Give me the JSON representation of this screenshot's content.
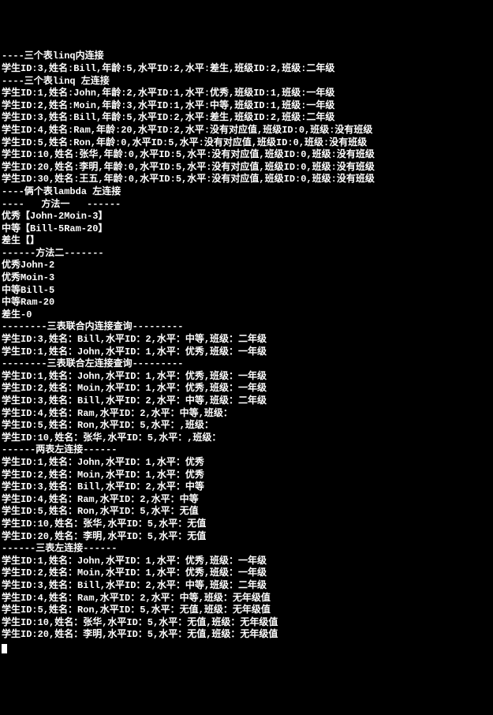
{
  "lines": [
    "----三个表linq内连接",
    "学生ID:3,姓名:Bill,年龄:5,水平ID:2,水平:差生,班级ID:2,班级:二年级",
    "----三个表linq 左连接",
    "学生ID:1,姓名:John,年龄:2,水平ID:1,水平:优秀,班级ID:1,班级:一年级",
    "学生ID:2,姓名:Moin,年龄:3,水平ID:1,水平:中等,班级ID:1,班级:一年级",
    "学生ID:3,姓名:Bill,年龄:5,水平ID:2,水平:差生,班级ID:2,班级:二年级",
    "学生ID:4,姓名:Ram,年龄:20,水平ID:2,水平:没有对应值,班级ID:0,班级:没有班级",
    "学生ID:5,姓名:Ron,年龄:0,水平ID:5,水平:没有对应值,班级ID:0,班级:没有班级",
    "学生ID:10,姓名:张华,年龄:0,水平ID:5,水平:没有对应值,班级ID:0,班级:没有班级",
    "学生ID:20,姓名:李明,年龄:0,水平ID:5,水平:没有对应值,班级ID:0,班级:没有班级",
    "学生ID:30,姓名:王五,年龄:0,水平ID:5,水平:没有对应值,班级ID:0,班级:没有班级",
    "",
    "----俩个表lambda 左连接",
    "",
    "----   方法一   ------",
    "",
    "优秀【John-2Moin-3】",
    "中等【Bill-5Ram-20】",
    "差生【】",
    "",
    "------方法二-------",
    "",
    "优秀John-2",
    "优秀Moin-3",
    "中等Bill-5",
    "中等Ram-20",
    "差生-0",
    "--------三表联合内连接查询---------",
    "学生ID:3,姓名：Bill,水平ID：2,水平：中等,班级：二年级",
    "学生ID:1,姓名：John,水平ID：1,水平：优秀,班级：一年级",
    "--------三表联合左连接查询---------",
    "学生ID:1,姓名：John,水平ID：1,水平：优秀,班级：一年级",
    "学生ID:2,姓名：Moin,水平ID：1,水平：优秀,班级：一年级",
    "学生ID:3,姓名：Bill,水平ID：2,水平：中等,班级：二年级",
    "学生ID:4,姓名：Ram,水平ID：2,水平：中等,班级：",
    "学生ID:5,姓名：Ron,水平ID：5,水平：,班级：",
    "学生ID:10,姓名：张华,水平ID：5,水平：,班级：",
    "------两表左连接------",
    "学生ID:1,姓名：John,水平ID：1,水平：优秀",
    "学生ID:2,姓名：Moin,水平ID：1,水平：优秀",
    "学生ID:3,姓名：Bill,水平ID：2,水平：中等",
    "学生ID:4,姓名：Ram,水平ID：2,水平：中等",
    "学生ID:5,姓名：Ron,水平ID：5,水平：无值",
    "学生ID:10,姓名：张华,水平ID：5,水平：无值",
    "学生ID:20,姓名：李明,水平ID：5,水平：无值",
    "------三表左连接------",
    "学生ID:1,姓名：John,水平ID：1,水平：优秀,班级：一年级",
    "学生ID:2,姓名：Moin,水平ID：1,水平：优秀,班级：一年级",
    "学生ID:3,姓名：Bill,水平ID：2,水平：中等,班级：二年级",
    "学生ID:4,姓名：Ram,水平ID：2,水平：中等,班级：无年级值",
    "学生ID:5,姓名：Ron,水平ID：5,水平：无值,班级：无年级值",
    "学生ID:10,姓名：张华,水平ID：5,水平：无值,班级：无年级值",
    "学生ID:20,姓名：李明,水平ID：5,水平：无值,班级：无年级值"
  ]
}
